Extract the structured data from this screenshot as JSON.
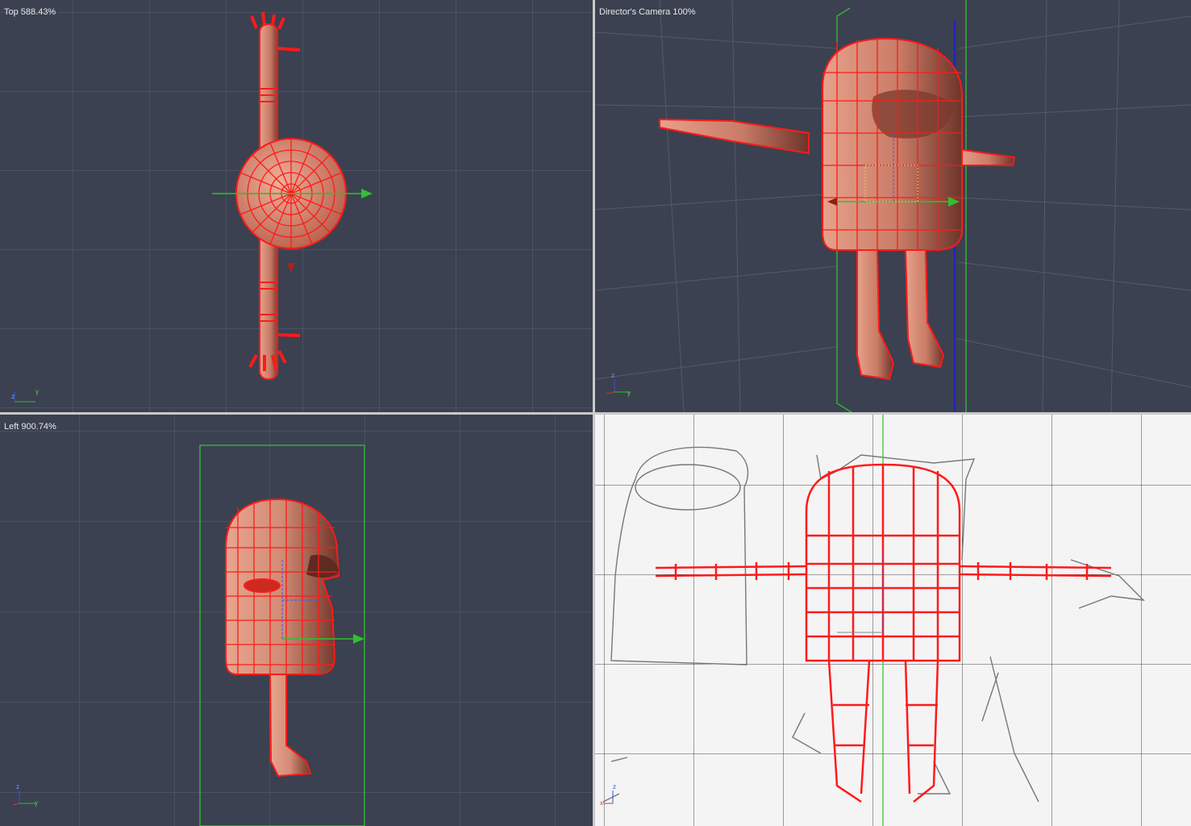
{
  "viewports": {
    "top": {
      "label": "Top 588.43%"
    },
    "camera": {
      "label": "Director's Camera 100%"
    },
    "left": {
      "label": "Left 900.74%"
    },
    "front": {
      "label": ""
    }
  },
  "axis_labels": {
    "z": "z",
    "y": "y",
    "x": "x"
  },
  "colors": {
    "viewport_bg": "#3b4150",
    "grid_line": "#5a6070",
    "mesh_wire": "#ff1a1a",
    "mesh_fill": "#d98a75",
    "manipulator_x": "#2ec12e",
    "manipulator_z": "#2222bb",
    "bounds": "#33cc33",
    "sketch_bg": "#f4f4f5"
  }
}
